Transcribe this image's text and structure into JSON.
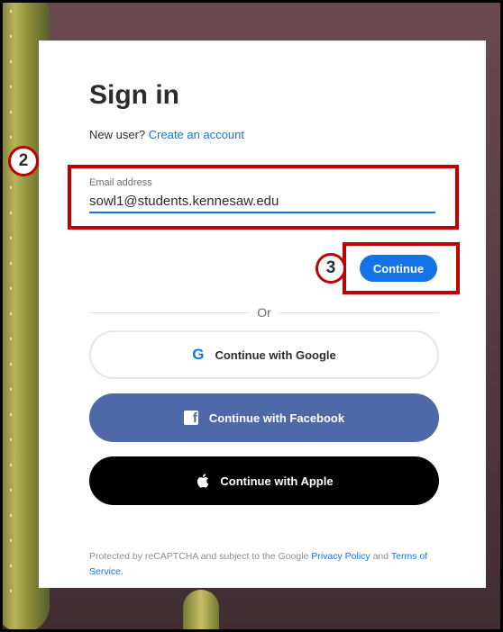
{
  "title": "Sign in",
  "new_user": {
    "prompt": "New user?",
    "link": "Create an account"
  },
  "email": {
    "label": "Email address",
    "value": "sowl1@students.kennesaw.edu"
  },
  "continue_label": "Continue",
  "divider_text": "Or",
  "social": {
    "google": "Continue with Google",
    "facebook": "Continue with Facebook",
    "apple": "Continue with Apple"
  },
  "annotations": {
    "step_email": "2",
    "step_continue": "3"
  },
  "footer": {
    "text": "Protected by reCAPTCHA and subject to the Google",
    "privacy": "Privacy Policy",
    "and": "and",
    "terms": "Terms of Service",
    "end": "."
  },
  "colors": {
    "accent": "#1473e6",
    "facebook": "#4e68a8",
    "apple": "#000000",
    "annotation": "#c00000"
  }
}
